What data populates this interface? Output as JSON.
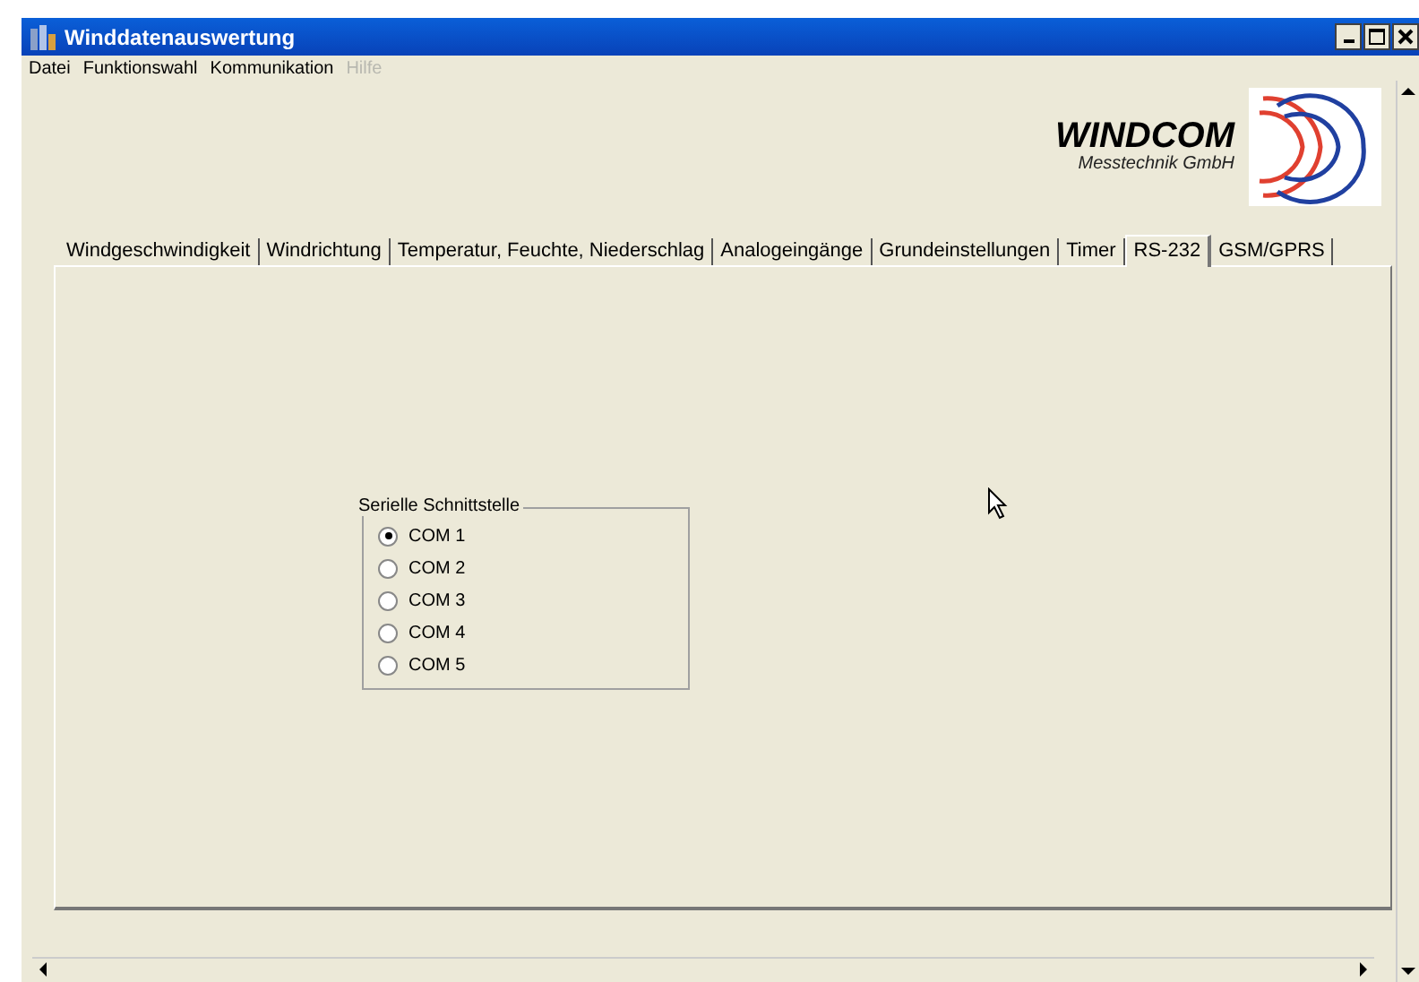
{
  "window": {
    "title": "Winddatenauswertung"
  },
  "menu": [
    {
      "label": "Datei",
      "disabled": false
    },
    {
      "label": "Funktionswahl",
      "disabled": false
    },
    {
      "label": "Kommunikation",
      "disabled": false
    },
    {
      "label": "Hilfe",
      "disabled": true
    }
  ],
  "logo": {
    "name": "WINDCOM",
    "subtitle": "Messtechnik GmbH"
  },
  "tabs": [
    {
      "label": "Windgeschwindigkeit",
      "selected": false
    },
    {
      "label": "Windrichtung",
      "selected": false
    },
    {
      "label": "Temperatur, Feuchte, Niederschlag",
      "selected": false
    },
    {
      "label": "Analogeingänge",
      "selected": false
    },
    {
      "label": "Grundeinstellungen",
      "selected": false
    },
    {
      "label": "Timer",
      "selected": false
    },
    {
      "label": "RS-232",
      "selected": true
    },
    {
      "label": "GSM/GPRS",
      "selected": false
    }
  ],
  "group": {
    "title": "Serielle Schnittstelle",
    "options": [
      {
        "label": "COM 1",
        "selected": true
      },
      {
        "label": "COM 2",
        "selected": false
      },
      {
        "label": "COM 3",
        "selected": false
      },
      {
        "label": "COM 4",
        "selected": false
      },
      {
        "label": "COM 5",
        "selected": false
      }
    ]
  }
}
